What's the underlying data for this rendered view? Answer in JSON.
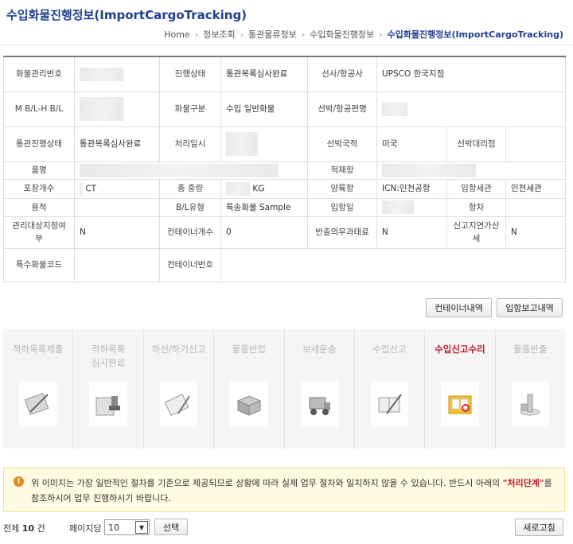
{
  "page": {
    "title": "수입화물진행정보(ImportCargoTracking)"
  },
  "breadcrumb": [
    "Home",
    "정보조회",
    "통관물류정보",
    "수입화물진행정보"
  ],
  "breadcrumb_current": "수입화물진행정보(ImportCargoTracking)",
  "info": {
    "r1": {
      "l1": "화물관리번호",
      "l2": "진행상태",
      "v2": "통관목록심사완료",
      "l3": "선사/항공사",
      "v3": "UPSCO 한국지점"
    },
    "r2": {
      "l1": "M B/L-H B/L",
      "l2": "화물구분",
      "v2": "수입 일반화물",
      "l3": "선박/항공편명"
    },
    "r3": {
      "l1": "통관진행상태",
      "v1": "통관목록심사완료",
      "l2": "처리일시",
      "l3": "선박국적",
      "v3": "미국",
      "l4": "선박대리점"
    },
    "r4": {
      "l1": "품명",
      "l3": "적재항"
    },
    "r5": {
      "l1": "포장개수",
      "v1": "CT",
      "l2": "총 중량",
      "v2": "KG",
      "l3": "양륙항",
      "v3": "ICN:인천공항",
      "l4": "입항세관",
      "v4": "인천세관"
    },
    "r6": {
      "l1": "용적",
      "l2": "B/L유형",
      "v2": "특송화물 Sample",
      "l3": "입항일",
      "l4": "항차"
    },
    "r7": {
      "l1": "관리대상지정여부",
      "v1": "N",
      "l2": "컨테이너개수",
      "v2": "0",
      "l3": "반출의무과태료",
      "v3": "N",
      "l4": "신고지연가산세",
      "v4": "N"
    },
    "r8": {
      "l1": "특수화물코드",
      "l2": "컨테이너번호"
    }
  },
  "buttons": {
    "container": "컨테이너내역",
    "arrival": "입항보고내역",
    "select": "선택",
    "refresh": "새로고침"
  },
  "steps": [
    {
      "name": "적하목록제출",
      "icon": "document-pen-icon",
      "active": false
    },
    {
      "name": "적하목록\n심사완료",
      "icon": "stamp-icon",
      "active": false
    },
    {
      "name": "하선/하기신고",
      "icon": "clipboard-pen-icon",
      "active": false
    },
    {
      "name": "물품반입",
      "icon": "box-icon",
      "active": false
    },
    {
      "name": "보세운송",
      "icon": "forklift-icon",
      "active": false
    },
    {
      "name": "수입신고",
      "icon": "book-pen-icon",
      "active": false
    },
    {
      "name": "수입신고수리",
      "icon": "folder-icon",
      "active": true
    },
    {
      "name": "물품반출",
      "icon": "package-icon",
      "active": false
    }
  ],
  "notice": {
    "before": "위 이미지는 가장 일반적인 절차를 기준으로 제공되므로 상황에 따라 실제 업무 절차와 일치하지 않을 수 있습니다. 반드시 아래의 ",
    "highlight": "\"처리단계\"",
    "after": "를 참조하시어 업무 진행하시기 바랍니다."
  },
  "footer": {
    "total_prefix": "전체",
    "total_count": "10",
    "total_suffix": "건",
    "per_page_label": "페이지당",
    "per_page_value": "10"
  },
  "colors": {
    "title": "#1f3f8f",
    "active": "#c0192b",
    "notice_bg": "#fffbe3"
  }
}
